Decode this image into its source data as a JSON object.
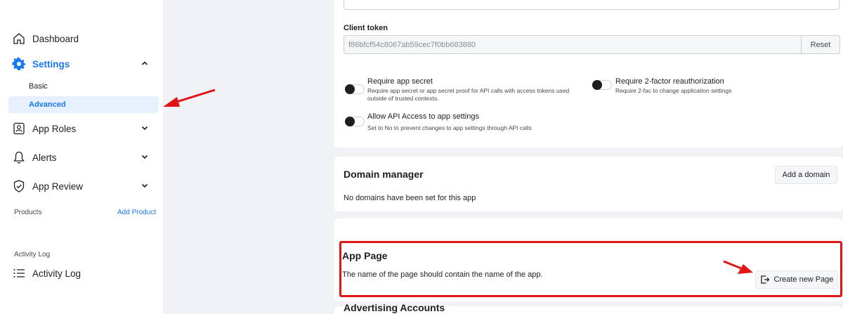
{
  "sidebar": {
    "items": [
      {
        "label": "Dashboard",
        "icon": "home-icon"
      },
      {
        "label": "Settings",
        "icon": "gear-icon"
      },
      {
        "label": "App Roles",
        "icon": "badge-icon"
      },
      {
        "label": "Alerts",
        "icon": "bell-icon"
      },
      {
        "label": "App Review",
        "icon": "shield-check-icon"
      },
      {
        "label": "Activity Log",
        "icon": "list-icon"
      }
    ],
    "settings_sub": [
      "Basic",
      "Advanced"
    ],
    "products_label": "Products",
    "add_product": "Add Product",
    "activity_section": "Activity Log"
  },
  "security": {
    "client_token_label": "Client token",
    "client_token_value": "f86bfcf54c8067ab59cec7f0bb683880",
    "reset_label": "Reset",
    "toggles": [
      {
        "title": "Require app secret",
        "desc1": "Require app secret or app secret proof for API calls with access tokens used",
        "desc2": "outside of trusted contexts.",
        "on": false
      },
      {
        "title": "Require 2-factor reauthorization",
        "desc1": "Require 2-fac to change application settings",
        "desc2": "",
        "on": false
      },
      {
        "title": "Allow API Access to app settings",
        "desc1": "Set to No to prevent changes to app settings through API calls",
        "desc2": "",
        "on": false
      }
    ]
  },
  "domain_manager": {
    "title": "Domain manager",
    "add_label": "Add a domain",
    "empty_text": "No domains have been set for this app"
  },
  "app_page": {
    "title": "App Page",
    "text": "The name of the page should contain the name of the app.",
    "create_label": "Create new Page"
  },
  "advertising": {
    "title": "Advertising Accounts"
  },
  "colors": {
    "accent": "#1877f2",
    "highlight": "#e01616",
    "selected_bg": "#e7f0fd"
  }
}
